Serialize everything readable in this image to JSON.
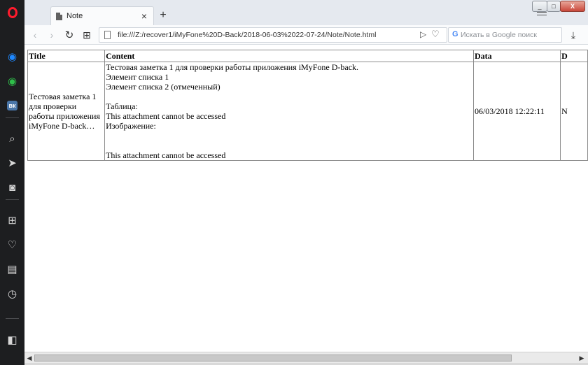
{
  "tab": {
    "title": "Note",
    "close": "×",
    "new_tab": "+"
  },
  "window_controls": {
    "minimize": "_",
    "maximize": "□",
    "close": "X"
  },
  "navbar": {
    "back": "‹",
    "forward": "›",
    "reload": "↻",
    "speed_dial": "⊞",
    "url": "file:///Z:/recover1/iMyFone%20D-Back/2018-06-03%2022-07-24/Note/Note.html",
    "search_placeholder": "Искать в Google поиск",
    "google_letter": "G"
  },
  "sidebar": {
    "items": [
      {
        "name": "messenger-icon",
        "glyph": "◉",
        "color": "#1e88ff"
      },
      {
        "name": "whatsapp-icon",
        "glyph": "◉",
        "color": "#2fbf4a"
      },
      {
        "name": "vk-icon",
        "glyph": "вк",
        "color": "#4a76a8"
      },
      {
        "name": "search-icon",
        "glyph": "⌕",
        "color": "#d7d7d7"
      },
      {
        "name": "send-icon",
        "glyph": "➤",
        "color": "#d7d7d7"
      },
      {
        "name": "camera-icon",
        "glyph": "◙",
        "color": "#d7d7d7"
      },
      {
        "name": "speed-dial-icon",
        "glyph": "⊞",
        "color": "#d7d7d7"
      },
      {
        "name": "heart-icon",
        "glyph": "♡",
        "color": "#d7d7d7"
      },
      {
        "name": "news-icon",
        "glyph": "▤",
        "color": "#d7d7d7"
      },
      {
        "name": "history-icon",
        "glyph": "◷",
        "color": "#d7d7d7"
      },
      {
        "name": "sidebar-toggle-icon",
        "glyph": "◧",
        "color": "#d7d7d7"
      }
    ]
  },
  "table": {
    "headers": [
      "Title",
      "Content",
      "Data",
      "D"
    ],
    "row": {
      "title": "Тестовая заметка 1 для проверки работы приложения iMyFone D-back…",
      "content_lines": [
        "Тестовая заметка 1 для проверки работы приложения iMyFone D-back.",
        "Элемент списка 1",
        "Элемент списка 2 (отмеченный)",
        "",
        "Таблица:",
        "This attachment cannot be accessed",
        "Изображение:",
        "",
        "",
        "This attachment cannot be accessed"
      ],
      "data": "06/03/2018 12:22:11",
      "d": "N"
    }
  },
  "scrollbar": {
    "left": "◀",
    "right": "▶"
  }
}
